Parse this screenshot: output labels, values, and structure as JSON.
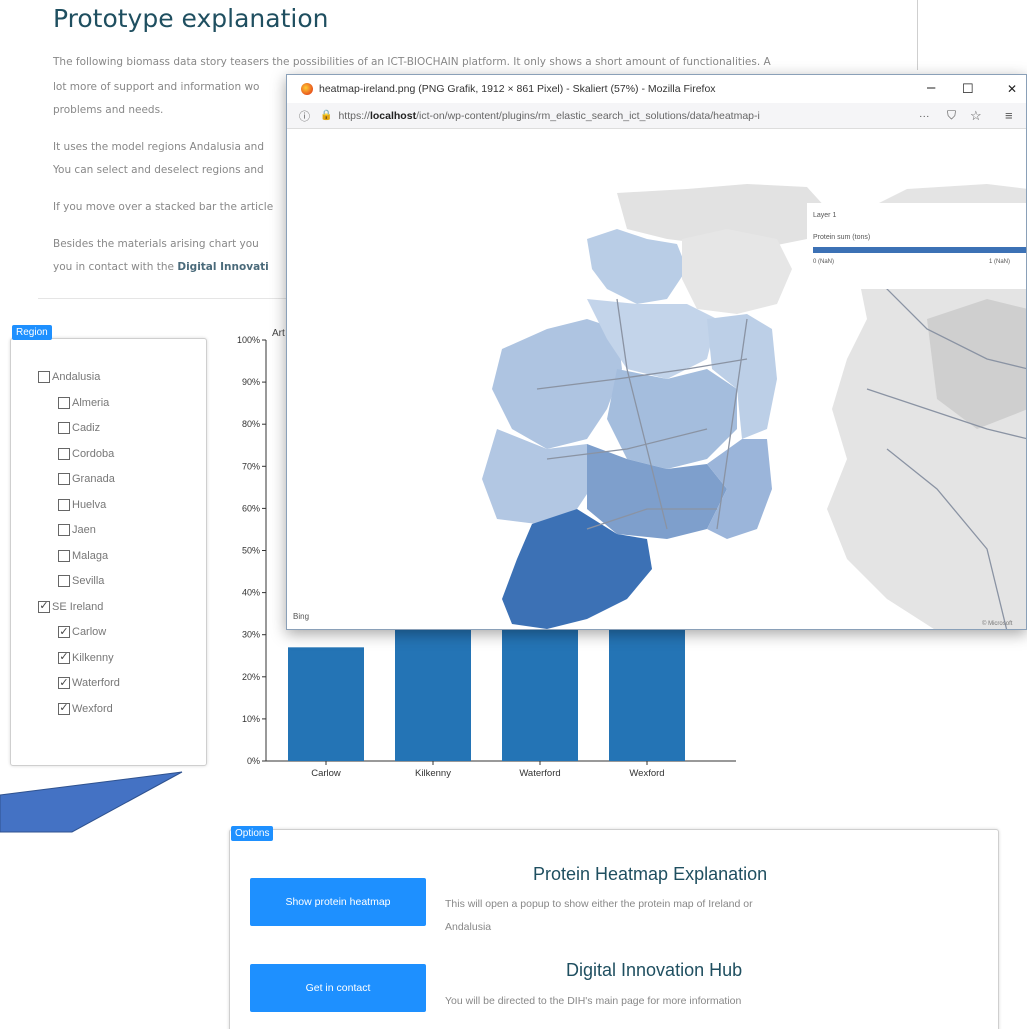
{
  "intro": {
    "title": "Prototype explanation",
    "p1_line1": "The following biomass data story teasers the possibilities of an ICT-BIOCHAIN platform. It only shows a short amount of functionalities. A",
    "p1_line2": "lot more of support and information wo",
    "p1_line3": "problems and needs.",
    "p2_line1": "It uses the model regions Andalusia and",
    "p2_line2": "You can select and deselect regions and",
    "p3_line1": "If you move over a stacked bar the article",
    "p4_line1": "Besides the materials arising chart you",
    "p4_line2_prefix": "you in contact with the ",
    "p4_line2_bold": "Digital Innovati"
  },
  "region": {
    "legend": "Region",
    "items": [
      {
        "label": "Andalusia",
        "checked": false,
        "indent": false
      },
      {
        "label": "Almeria",
        "checked": false,
        "indent": true
      },
      {
        "label": "Cadiz",
        "checked": false,
        "indent": true
      },
      {
        "label": "Cordoba",
        "checked": false,
        "indent": true
      },
      {
        "label": "Granada",
        "checked": false,
        "indent": true
      },
      {
        "label": "Huelva",
        "checked": false,
        "indent": true
      },
      {
        "label": "Jaen",
        "checked": false,
        "indent": true
      },
      {
        "label": "Malaga",
        "checked": false,
        "indent": true
      },
      {
        "label": "Sevilla",
        "checked": false,
        "indent": true
      },
      {
        "label": "SE Ireland",
        "checked": true,
        "indent": false
      },
      {
        "label": "Carlow",
        "checked": true,
        "indent": true
      },
      {
        "label": "Kilkenny",
        "checked": true,
        "indent": true
      },
      {
        "label": "Waterford",
        "checked": true,
        "indent": true
      },
      {
        "label": "Wexford",
        "checked": true,
        "indent": true
      }
    ]
  },
  "chart_data": {
    "type": "bar",
    "title": "Art",
    "categories": [
      "Carlow",
      "Kilkenny",
      "Waterford",
      "Wexford"
    ],
    "values": [
      27,
      33,
      33,
      33
    ],
    "ytick_labels": [
      "0%",
      "10%",
      "20%",
      "30%",
      "40%",
      "50%",
      "60%",
      "70%",
      "80%",
      "90%",
      "100%"
    ],
    "ylim": [
      0,
      100
    ],
    "bar_color": "#2474b5"
  },
  "options": {
    "legend": "Options",
    "heatmap_button": "Show protein heatmap",
    "contact_button": "Get in contact",
    "heatmap_title": "Protein Heatmap Explanation",
    "heatmap_text_line1": "This will open a popup to show either the protein map of Ireland or",
    "heatmap_text_line2": "Andalusia",
    "hub_title": "Digital Innovation Hub",
    "hub_text": "You will be directed to the DIH's main page for more information",
    "accent": "#1e90ff"
  },
  "popup": {
    "window_title": "heatmap-ireland.png (PNG Grafik, 1912 × 861 Pixel) - Skaliert (57%) - Mozilla Firefox",
    "url_prefix": "https://",
    "url_bold": "localhost",
    "url_rest": "/ict-on/wp-content/plugins/rm_elastic_search_ict_solutions/data/heatmap-i",
    "url_more": "···",
    "layer_name": "Layer 1",
    "layer_field": "Protein sum (tons)",
    "legend_min": "0 (NaN)",
    "legend_max": "1 (NaN)",
    "map_credit": "Bing",
    "map_copyright": "© Microsoft",
    "minimize_glyph": "–",
    "maximize_glyph": "☐",
    "close_glyph": "✕"
  }
}
